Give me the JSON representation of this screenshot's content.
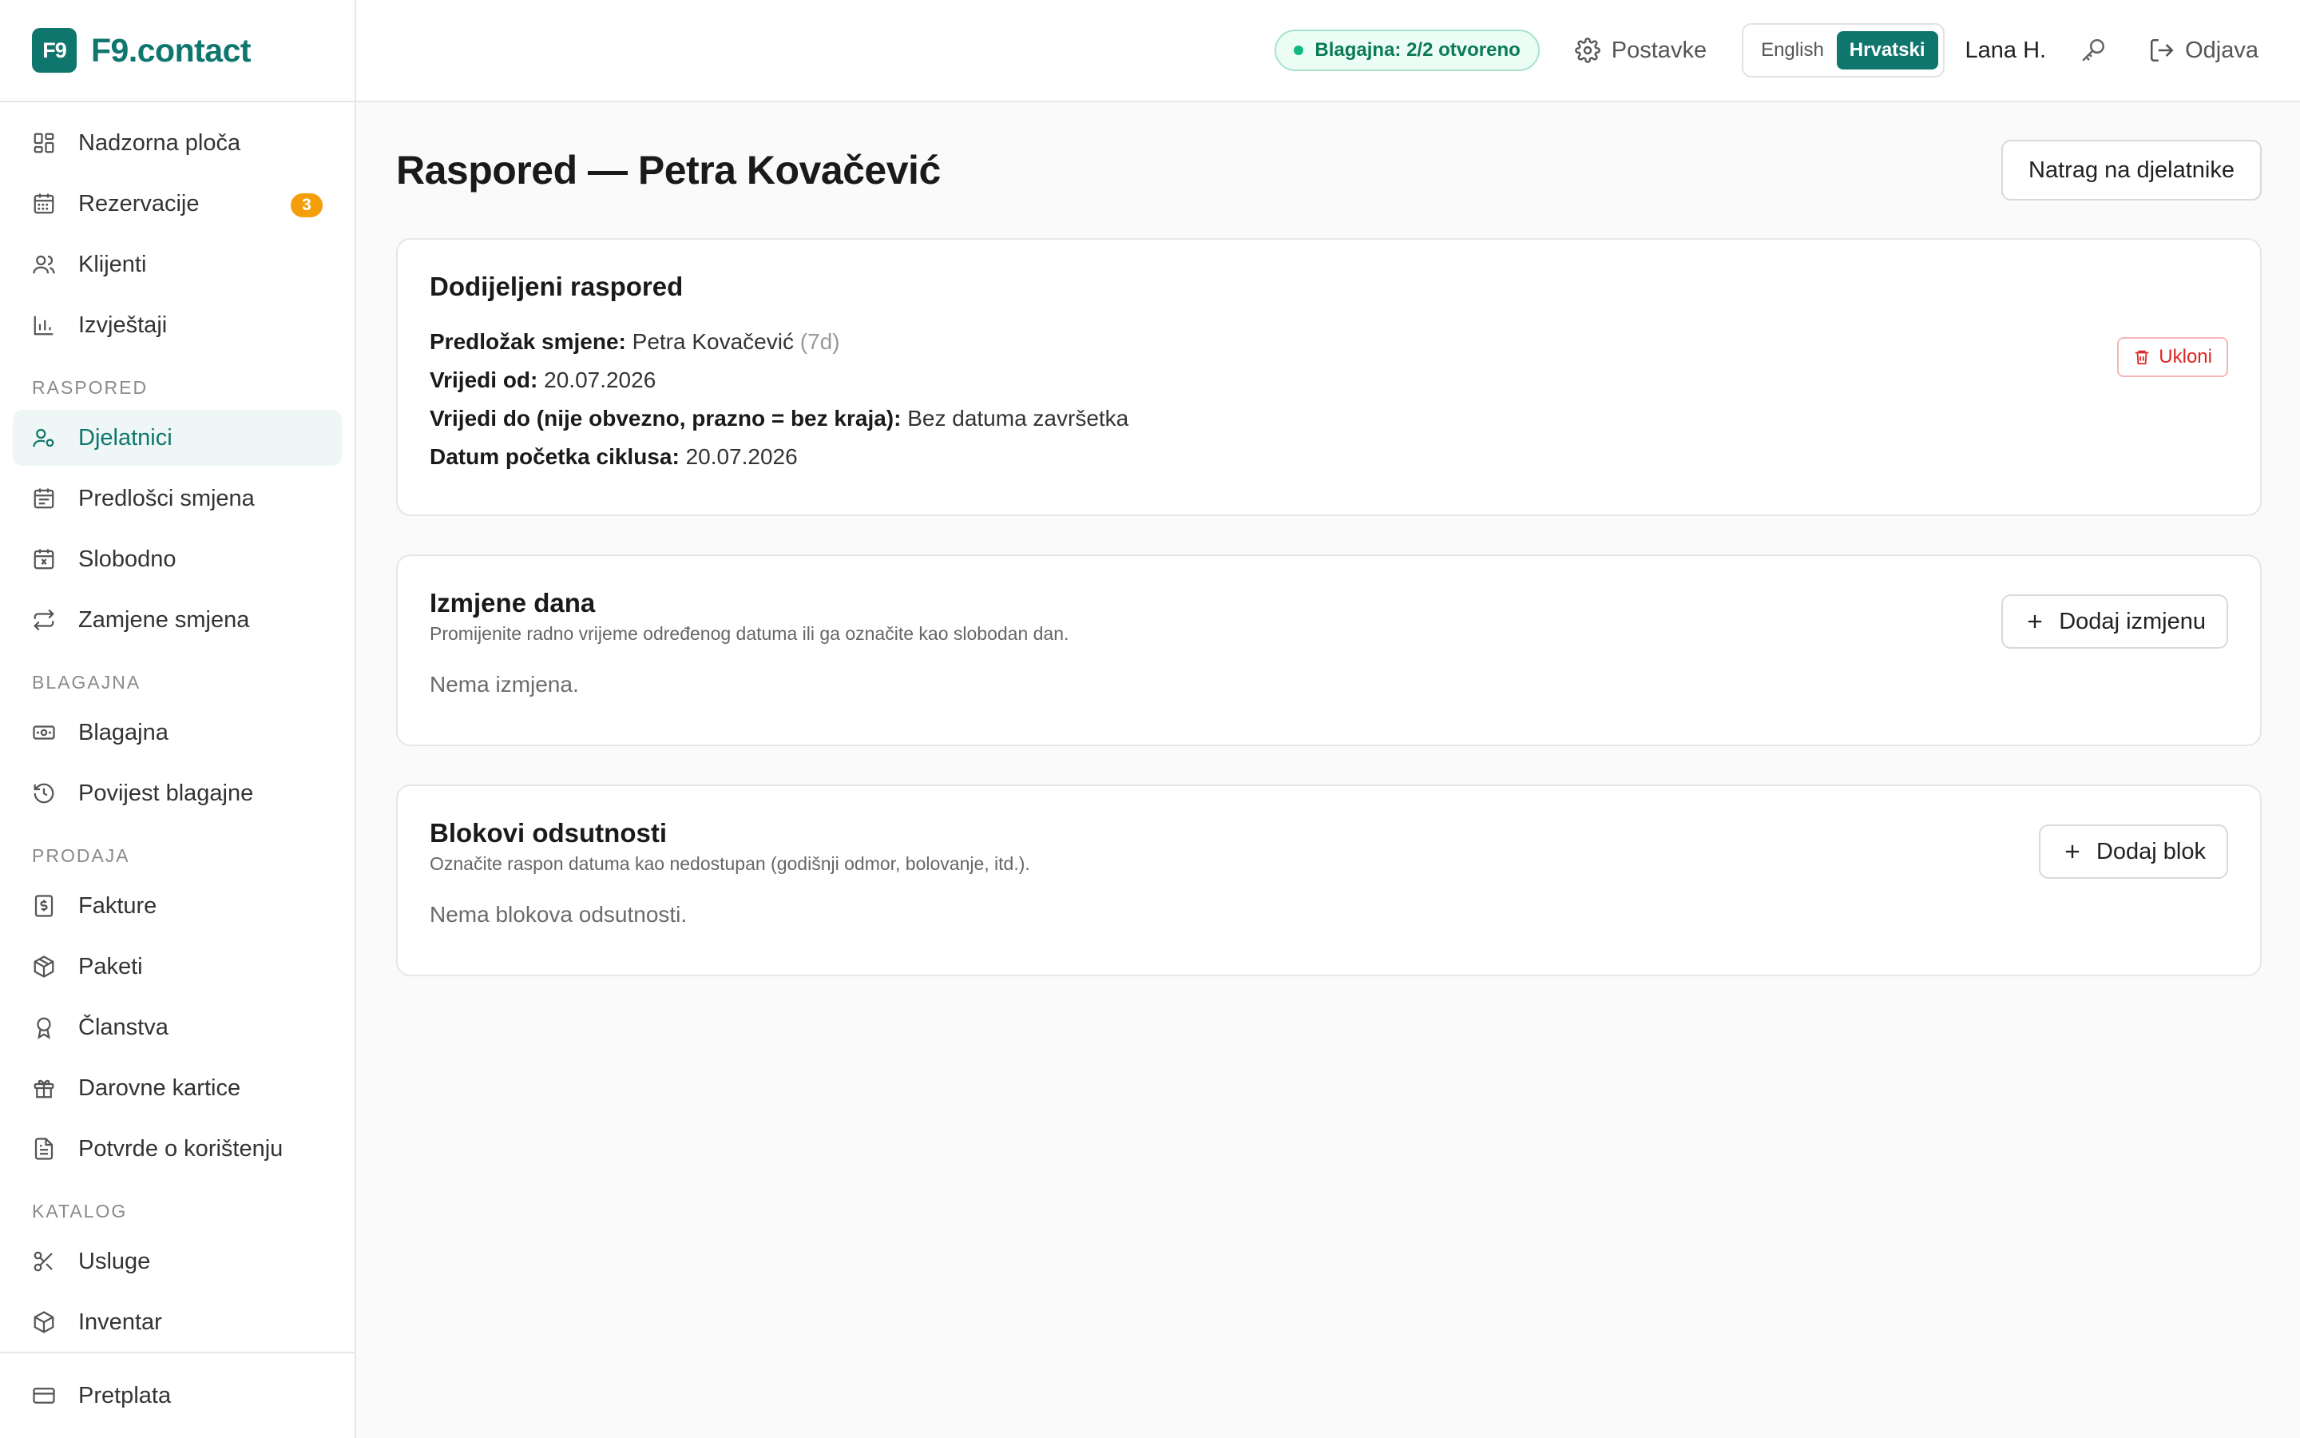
{
  "brand": {
    "logo_text": "F9",
    "name": "F9.contact"
  },
  "sidebar": {
    "items_top": [
      {
        "label": "Nadzorna ploča",
        "icon": "dashboard-icon"
      },
      {
        "label": "Rezervacije",
        "icon": "calendar-icon",
        "badge": "3"
      },
      {
        "label": "Klijenti",
        "icon": "users-icon"
      },
      {
        "label": "Izvještaji",
        "icon": "bar-chart-icon"
      }
    ],
    "section_schedule": "RASPORED",
    "items_schedule": [
      {
        "label": "Djelatnici",
        "icon": "user-cog-icon",
        "active": true
      },
      {
        "label": "Predlošci smjena",
        "icon": "calendar-template-icon"
      },
      {
        "label": "Slobodno",
        "icon": "calendar-off-icon"
      },
      {
        "label": "Zamjene smjena",
        "icon": "swap-icon"
      }
    ],
    "section_cash": "BLAGAJNA",
    "items_cash": [
      {
        "label": "Blagajna",
        "icon": "banknote-icon"
      },
      {
        "label": "Povijest blagajne",
        "icon": "history-icon"
      }
    ],
    "section_sales": "PRODAJA",
    "items_sales": [
      {
        "label": "Fakture",
        "icon": "invoice-icon"
      },
      {
        "label": "Paketi",
        "icon": "package-icon"
      },
      {
        "label": "Članstva",
        "icon": "award-icon"
      },
      {
        "label": "Darovne kartice",
        "icon": "gift-icon"
      },
      {
        "label": "Potvrde o korištenju",
        "icon": "document-icon"
      }
    ],
    "section_catalog": "KATALOG",
    "items_catalog": [
      {
        "label": "Usluge",
        "icon": "scissors-icon"
      },
      {
        "label": "Inventar",
        "icon": "box-icon"
      }
    ],
    "bottom_item": {
      "label": "Pretplata",
      "icon": "credit-card-icon"
    }
  },
  "header": {
    "cash_status": "Blagajna: 2/2 otvoreno",
    "settings_label": "Postavke",
    "lang_english": "English",
    "lang_croatian": "Hrvatski",
    "active_language": "Hrvatski",
    "user_name": "Lana H.",
    "logout_label": "Odjava"
  },
  "main": {
    "title": "Raspored — Petra Kovačević",
    "back_button": "Natrag na djelatnike",
    "assigned": {
      "title": "Dodijeljeni raspored",
      "remove_label": "Ukloni",
      "template_label": "Predložak smjene:",
      "template_value": "Petra Kovačević",
      "template_suffix": "(7d)",
      "valid_from_label": "Vrijedi od:",
      "valid_from_value": "20.07.2026",
      "valid_to_label": "Vrijedi do (nije obvezno, prazno = bez kraja):",
      "valid_to_value": "Bez datuma završetka",
      "cycle_start_label": "Datum početka ciklusa:",
      "cycle_start_value": "20.07.2026"
    },
    "overrides": {
      "title": "Izmjene dana",
      "subtitle": "Promijenite radno vrijeme određenog datuma ili ga označite kao slobodan dan.",
      "add_button": "Dodaj izmjenu",
      "empty": "Nema izmjena."
    },
    "absences": {
      "title": "Blokovi odsutnosti",
      "subtitle": "Označite raspon datuma kao nedostupan (godišnji odmor, bolovanje, itd.).",
      "add_button": "Dodaj blok",
      "empty": "Nema blokova odsutnosti."
    }
  },
  "colors": {
    "brand": "#0f766e",
    "active_bg": "#eef7f5",
    "badge": "#f59e0b",
    "success": "#10b981",
    "danger": "#dc2626"
  }
}
